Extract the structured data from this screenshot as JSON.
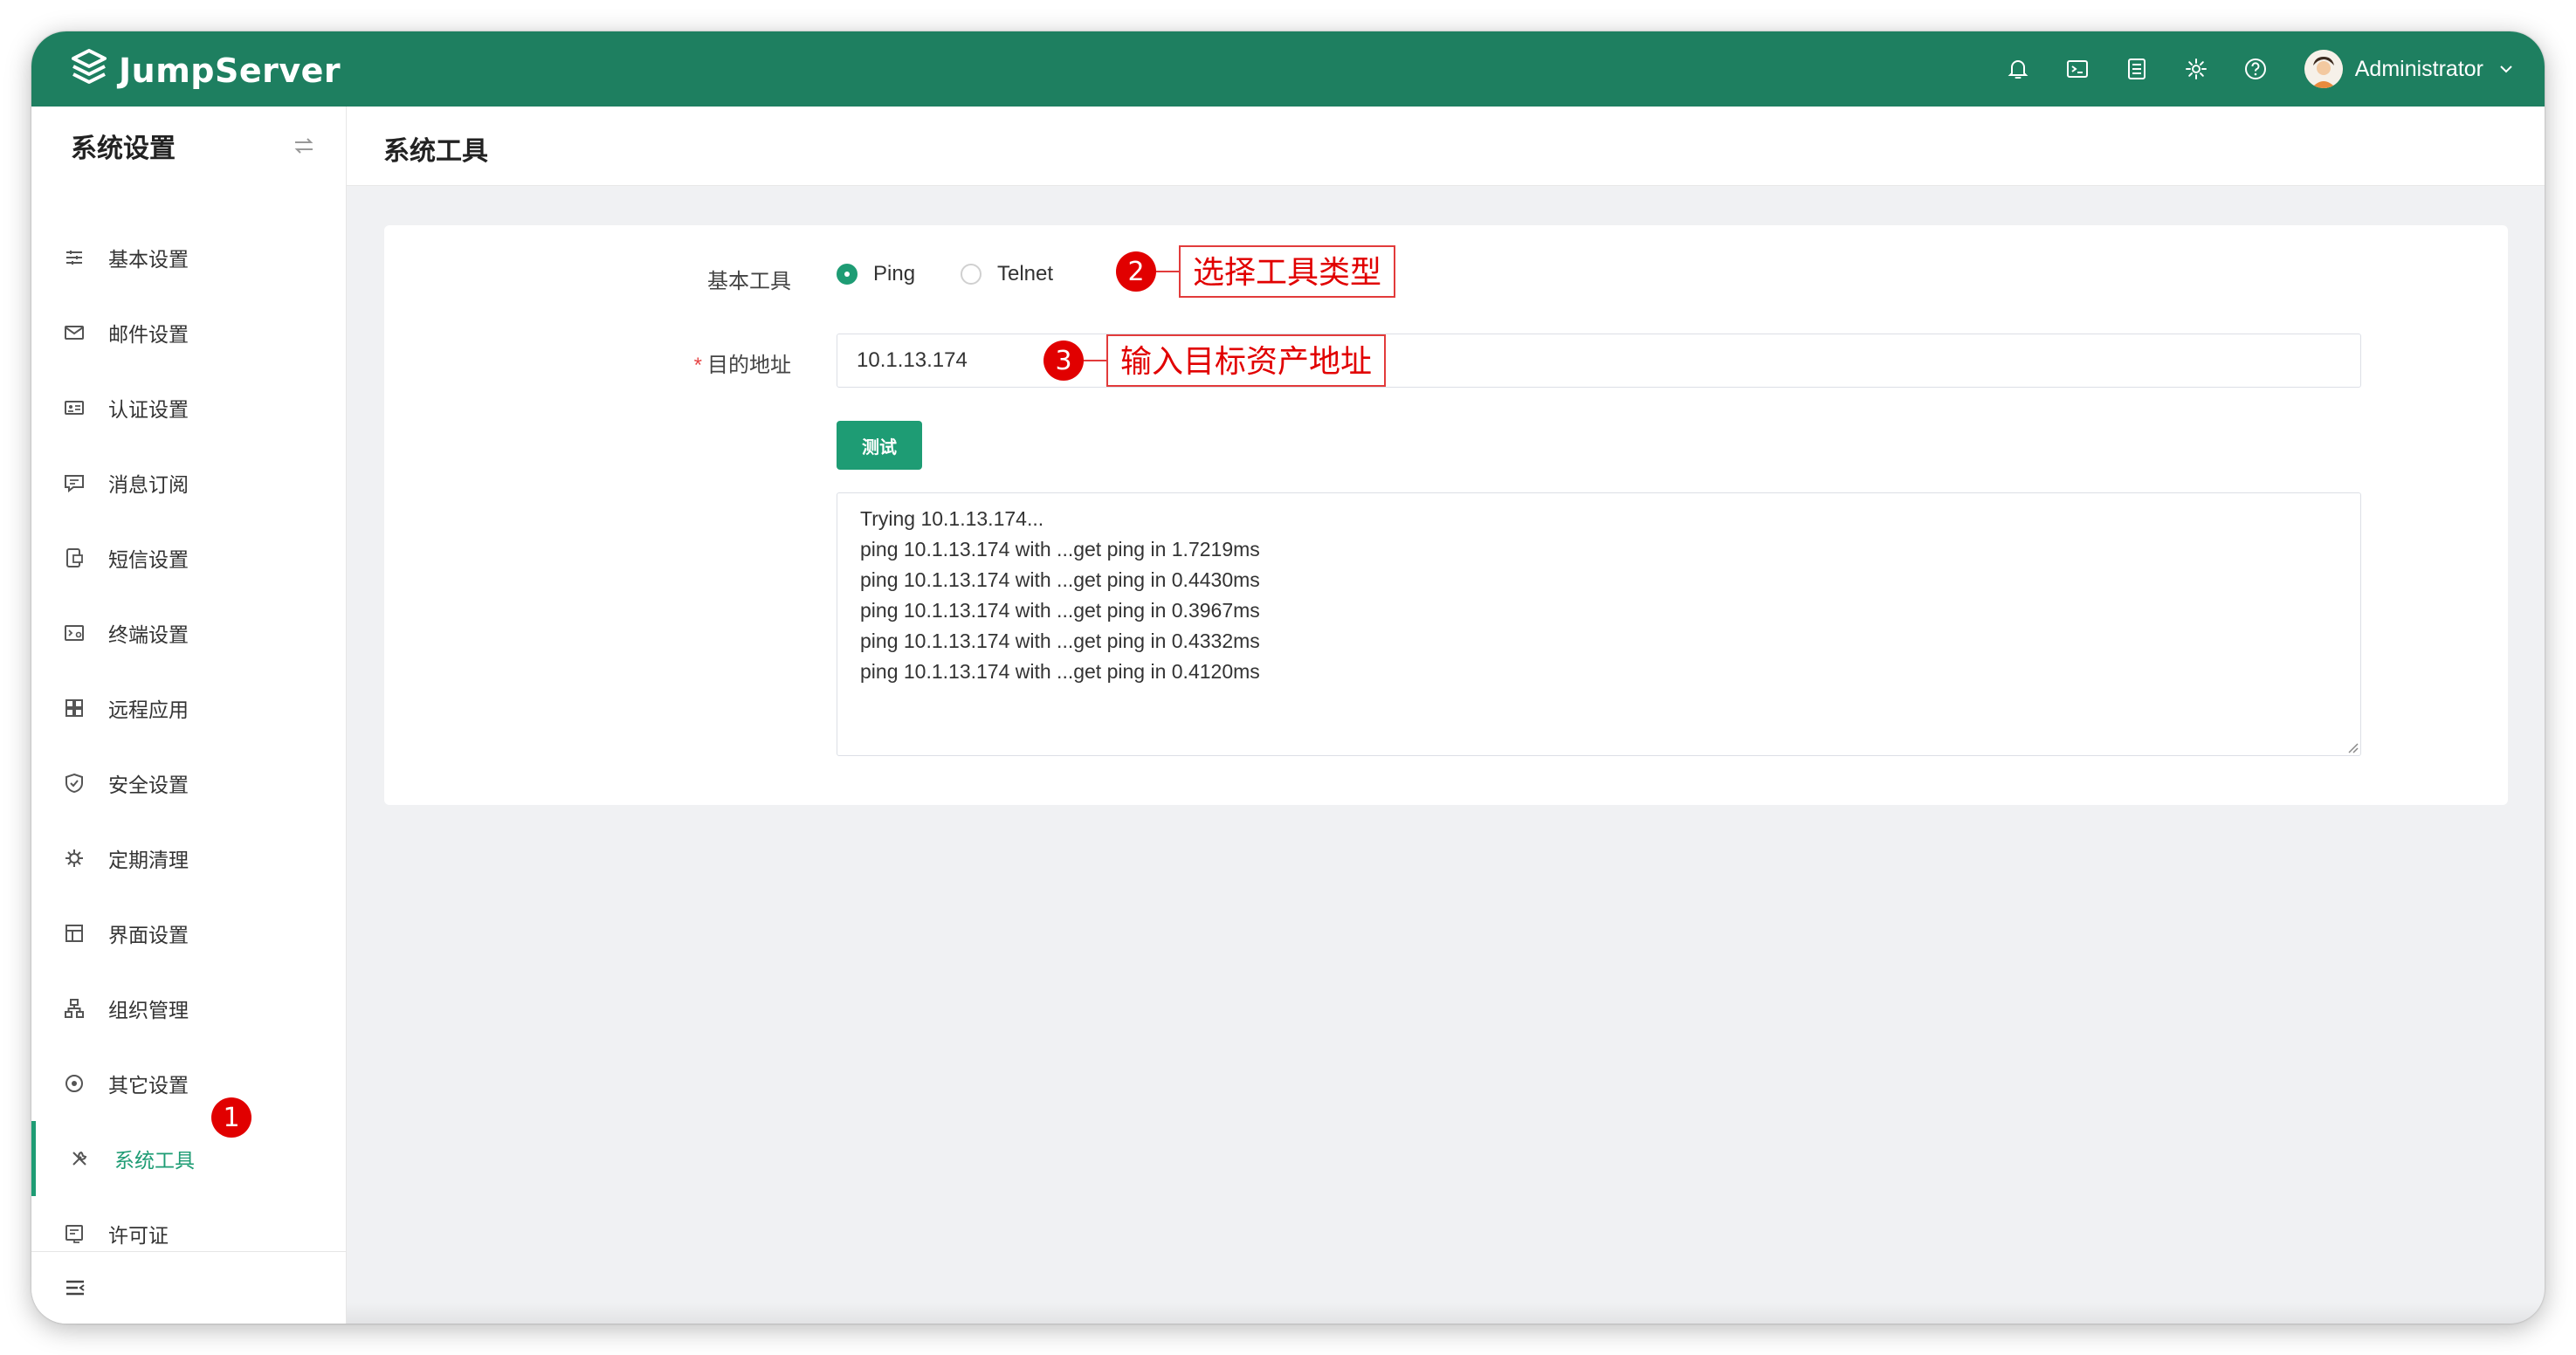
{
  "app": {
    "logo_text": "JumpServer",
    "brand_color": "#1e7f60",
    "accent_color": "#1e9c74"
  },
  "header": {
    "icons": [
      "bell-icon",
      "terminal-icon",
      "list-icon",
      "gear-icon",
      "help-icon"
    ],
    "user_name": "Administrator"
  },
  "sidebar": {
    "title": "系统设置",
    "items": [
      {
        "label": "基本设置",
        "icon": "sliders-icon"
      },
      {
        "label": "邮件设置",
        "icon": "mail-icon"
      },
      {
        "label": "认证设置",
        "icon": "id-card-icon"
      },
      {
        "label": "消息订阅",
        "icon": "message-icon"
      },
      {
        "label": "短信设置",
        "icon": "sms-icon"
      },
      {
        "label": "终端设置",
        "icon": "terminal-settings-icon"
      },
      {
        "label": "远程应用",
        "icon": "apps-icon"
      },
      {
        "label": "安全设置",
        "icon": "shield-icon"
      },
      {
        "label": "定期清理",
        "icon": "clean-icon"
      },
      {
        "label": "界面设置",
        "icon": "layout-icon"
      },
      {
        "label": "组织管理",
        "icon": "org-icon"
      },
      {
        "label": "其它设置",
        "icon": "target-icon"
      },
      {
        "label": "系统工具",
        "icon": "tools-icon",
        "active": true
      },
      {
        "label": "许可证",
        "icon": "license-icon"
      }
    ]
  },
  "page": {
    "title": "系统工具"
  },
  "form": {
    "tool_label": "基本工具",
    "tool_options": [
      "Ping",
      "Telnet"
    ],
    "tool_selected": "Ping",
    "required_mark": "*",
    "target_label": "目的地址",
    "target_value": "10.1.13.174",
    "test_button": "测试",
    "output_lines": [
      "Trying 10.1.13.174...",
      "ping 10.1.13.174 with ...get ping in 1.7219ms",
      "ping 10.1.13.174 with ...get ping in 0.4430ms",
      "ping 10.1.13.174 with ...get ping in 0.3967ms",
      "ping 10.1.13.174 with ...get ping in 0.4332ms",
      "ping 10.1.13.174 with ...get ping in 0.4120ms"
    ]
  },
  "annotations": [
    {
      "number": "1"
    },
    {
      "number": "2",
      "text": "选择工具类型"
    },
    {
      "number": "3",
      "text": "输入目标资产地址"
    }
  ]
}
